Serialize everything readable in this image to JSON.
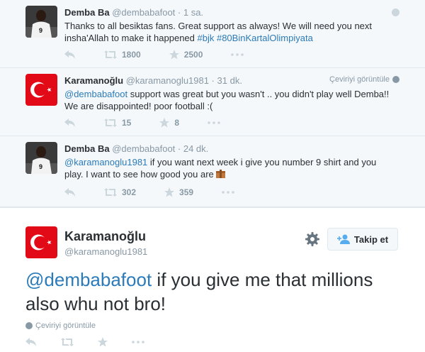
{
  "tweets": [
    {
      "name": "Demba Ba",
      "handle": "@dembabafoot",
      "time": "· 1 sa.",
      "text_plain": "Thanks to all besiktas fans. Great support as always! We will need you next insha'Allah to make it happened ",
      "hashtags": "#bjk #80BinKartalOlimpiyata",
      "retweets": "1800",
      "favorites": "2500"
    },
    {
      "name": "Karamanoğlu",
      "handle": "@karamanoglu1981",
      "time": "· 31 dk.",
      "translate": "Çeviriyi görüntüle",
      "mention": "@dembabafoot",
      "text_plain": " support was great but you wasn't .. you didn't play well Demba!! We are disappointed!  poor football :(",
      "retweets": "15",
      "favorites": "8"
    },
    {
      "name": "Demba Ba",
      "handle": "@dembabafoot",
      "time": "· 24 dk.",
      "mention": "@karamanoglu1981",
      "text_plain": " if you want next week i give you number 9 shirt and you play. I want to see how good you are ",
      "retweets": "302",
      "favorites": "359"
    }
  ],
  "main": {
    "name": "Karamanoğlu",
    "handle": "@karamanoglu1981",
    "follow_label": "Takip et",
    "mention": "@dembabafoot",
    "text_plain": " if you give me that millions also whu not bro!",
    "translate": "Çeviriyi görüntüle"
  },
  "icons": {
    "reply": "reply-icon",
    "retweet": "retweet-icon",
    "favorite": "star-icon",
    "more": "more-icon",
    "settings": "gear-icon",
    "follow": "add-user-icon",
    "emoji": "box-emoji-icon"
  },
  "colors": {
    "link": "#2b7bb9",
    "icon_gray": "#8899a6",
    "turkey_red": "#e30a17"
  }
}
